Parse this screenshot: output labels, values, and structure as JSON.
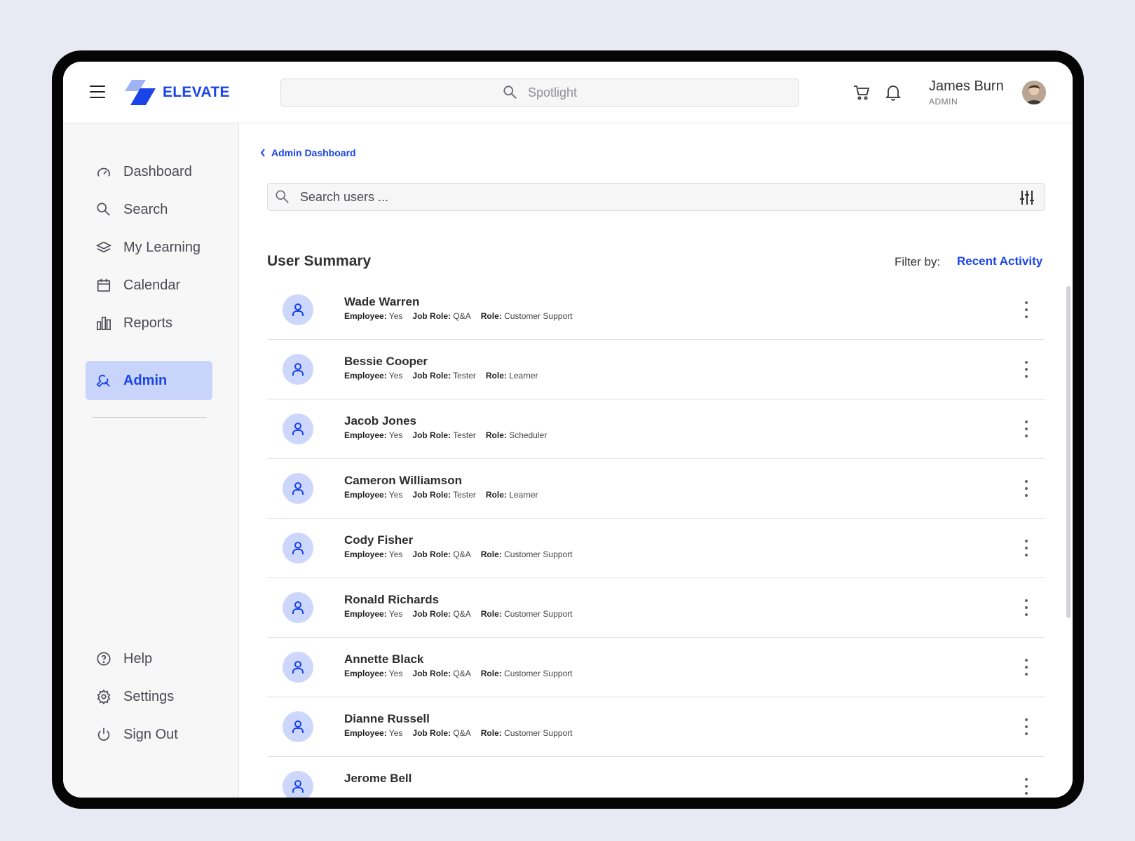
{
  "brand": {
    "name": "ELEVATE",
    "color": "#1a44e8"
  },
  "header": {
    "spotlight_placeholder": "Spotlight",
    "user_name": "James Burn",
    "user_role": "ADMIN"
  },
  "sidebar": {
    "items": [
      {
        "label": "Dashboard",
        "icon": "speedometer-icon"
      },
      {
        "label": "Search",
        "icon": "search-icon"
      },
      {
        "label": "My Learning",
        "icon": "layers-icon"
      },
      {
        "label": "Calendar",
        "icon": "calendar-icon"
      },
      {
        "label": "Reports",
        "icon": "bar-chart-icon"
      },
      {
        "label": "Admin",
        "icon": "wrench-icon",
        "active": true
      }
    ],
    "bottom_items": [
      {
        "label": "Help",
        "icon": "help-icon"
      },
      {
        "label": "Settings",
        "icon": "gear-icon"
      },
      {
        "label": "Sign Out",
        "icon": "power-icon"
      }
    ]
  },
  "main": {
    "breadcrumb": "Admin Dashboard",
    "search_placeholder": "Search users ...",
    "summary_title": "User Summary",
    "filter_label": "Filter by:",
    "filter_value": "Recent Activity",
    "labels": {
      "employee": "Employee:",
      "job_role": "Job Role:",
      "role": "Role:"
    },
    "users": [
      {
        "name": "Wade Warren",
        "employee": "Yes",
        "job_role": "Q&A",
        "role": "Customer Support"
      },
      {
        "name": "Bessie Cooper",
        "employee": "Yes",
        "job_role": "Tester",
        "role": "Learner"
      },
      {
        "name": "Jacob Jones",
        "employee": "Yes",
        "job_role": "Tester",
        "role": "Scheduler"
      },
      {
        "name": "Cameron Williamson",
        "employee": "Yes",
        "job_role": "Tester",
        "role": "Learner"
      },
      {
        "name": "Cody Fisher",
        "employee": "Yes",
        "job_role": "Q&A",
        "role": "Customer Support"
      },
      {
        "name": "Ronald Richards",
        "employee": "Yes",
        "job_role": "Q&A",
        "role": "Customer Support"
      },
      {
        "name": "Annette Black",
        "employee": "Yes",
        "job_role": "Q&A",
        "role": "Customer Support"
      },
      {
        "name": "Dianne Russell",
        "employee": "Yes",
        "job_role": "Q&A",
        "role": "Customer Support"
      },
      {
        "name": "Jerome Bell",
        "employee": "",
        "job_role": "",
        "role": ""
      }
    ]
  }
}
